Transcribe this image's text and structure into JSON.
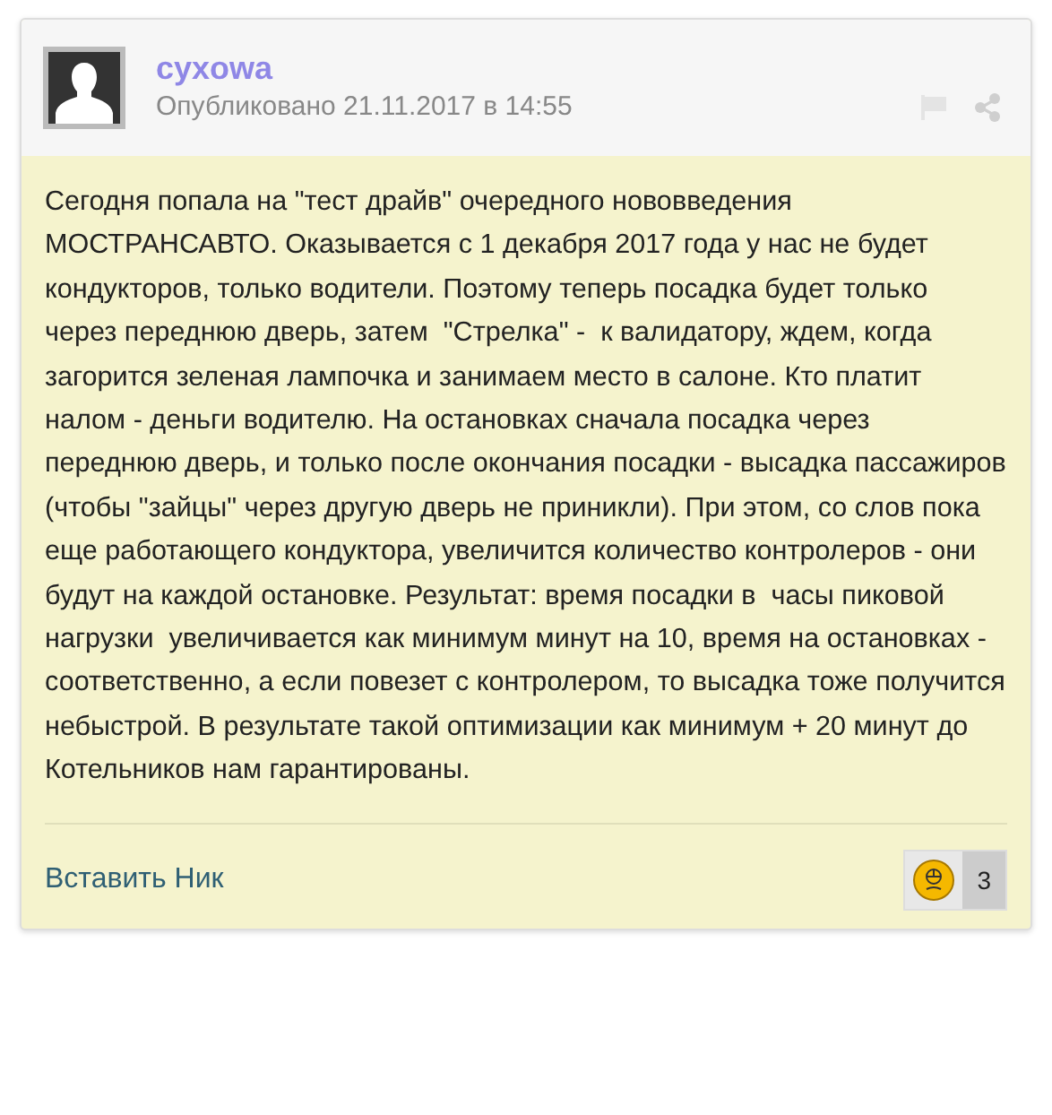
{
  "post": {
    "author": "cyxowa",
    "published": "Опубликовано 21.11.2017 в 14:55",
    "body": "Сегодня попала на \"тест драйв\" очередного нововведения МОСТРАНСАВТО. Оказывается с 1 декабря 2017 года у нас не будет кондукторов, только водители. Поэтому теперь посадка будет только через переднюю дверь, затем  \"Стрелка\" -  к валидатору, ждем, когда загорится зеленая лампочка и занимаем место в салоне. Кто платит налом - деньги водителю. На остановках сначала посадка через переднюю дверь, и только после окончания посадки - высадка пассажиров (чтобы \"зайцы\" через другую дверь не приникли). При этом, со слов пока еще работающего кондуктора, увеличится количество контролеров - они будут на каждой остановке. Результат: время посадки в  часы пиковой нагрузки  увеличивается как минимум минут на 10, время на остановках - соответственно, а если повезет с контролером, то высадка тоже получится небыстрой. В результате такой оптимизации как минимум + 20 минут до Котельников нам гарантированы.",
    "insert_nick": "Вставить Ник",
    "reaction_count": "3"
  }
}
